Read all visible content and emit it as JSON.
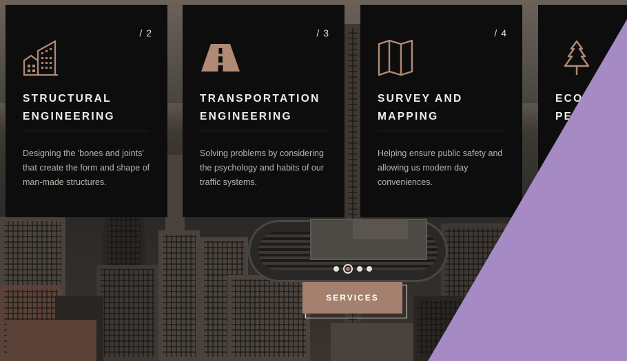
{
  "cards": [
    {
      "number": "/ 2",
      "icon": "building-icon",
      "title": "STRUCTURAL\nENGINEERING",
      "description": "Designing the 'bones and joints' that create the form and shape of man-made structures."
    },
    {
      "number": "/ 3",
      "icon": "road-icon",
      "title": "TRANSPORTATION\nENGINEERING",
      "description": "Solving problems by considering the psychology and habits of our traffic systems."
    },
    {
      "number": "/ 4",
      "icon": "map-icon",
      "title": "SURVEY AND\nMAPPING",
      "description": "Helping ensure public safety and allowing us modern day conveniences."
    },
    {
      "number": "",
      "icon": "tree-icon",
      "title": "ECO\nPE",
      "description": ""
    }
  ],
  "carousel": {
    "total": 4,
    "active": 1
  },
  "services_button": {
    "label": "SERVICES"
  },
  "colors": {
    "card_bg": "#0e0d0d",
    "accent": "#a4806e",
    "icon": "#b08a74",
    "overlay": "#a58ac4"
  }
}
